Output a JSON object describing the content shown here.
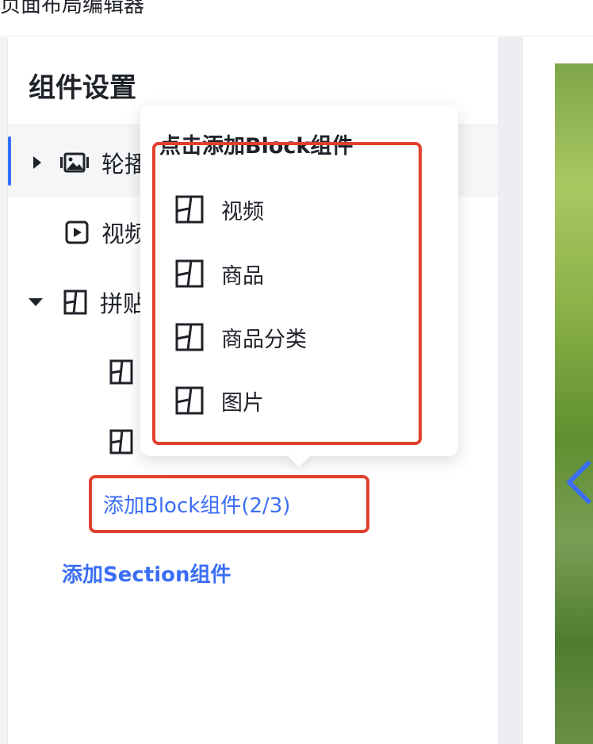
{
  "topbar": {
    "crumb": "页面布局编辑器"
  },
  "panel": {
    "title": "组件设置",
    "tree": [
      {
        "label": "轮播图",
        "icon": "image-icon",
        "expanded": false,
        "selected": true
      },
      {
        "label": "视频",
        "icon": "play-icon"
      },
      {
        "label": "拼贴",
        "icon": "layout-icon",
        "expanded": true
      }
    ],
    "add_block": "添加Block组件(2/3)",
    "add_section": "添加Section组件"
  },
  "popover": {
    "title": "点击添加Block组件",
    "items": [
      {
        "label": "视频",
        "icon": "layout-icon"
      },
      {
        "label": "商品",
        "icon": "layout-icon"
      },
      {
        "label": "商品分类",
        "icon": "layout-icon"
      },
      {
        "label": "图片",
        "icon": "layout-icon"
      }
    ]
  },
  "colors": {
    "accent": "#3b6ef6",
    "highlight_box": "#e0402e",
    "text": "#1f2329"
  }
}
